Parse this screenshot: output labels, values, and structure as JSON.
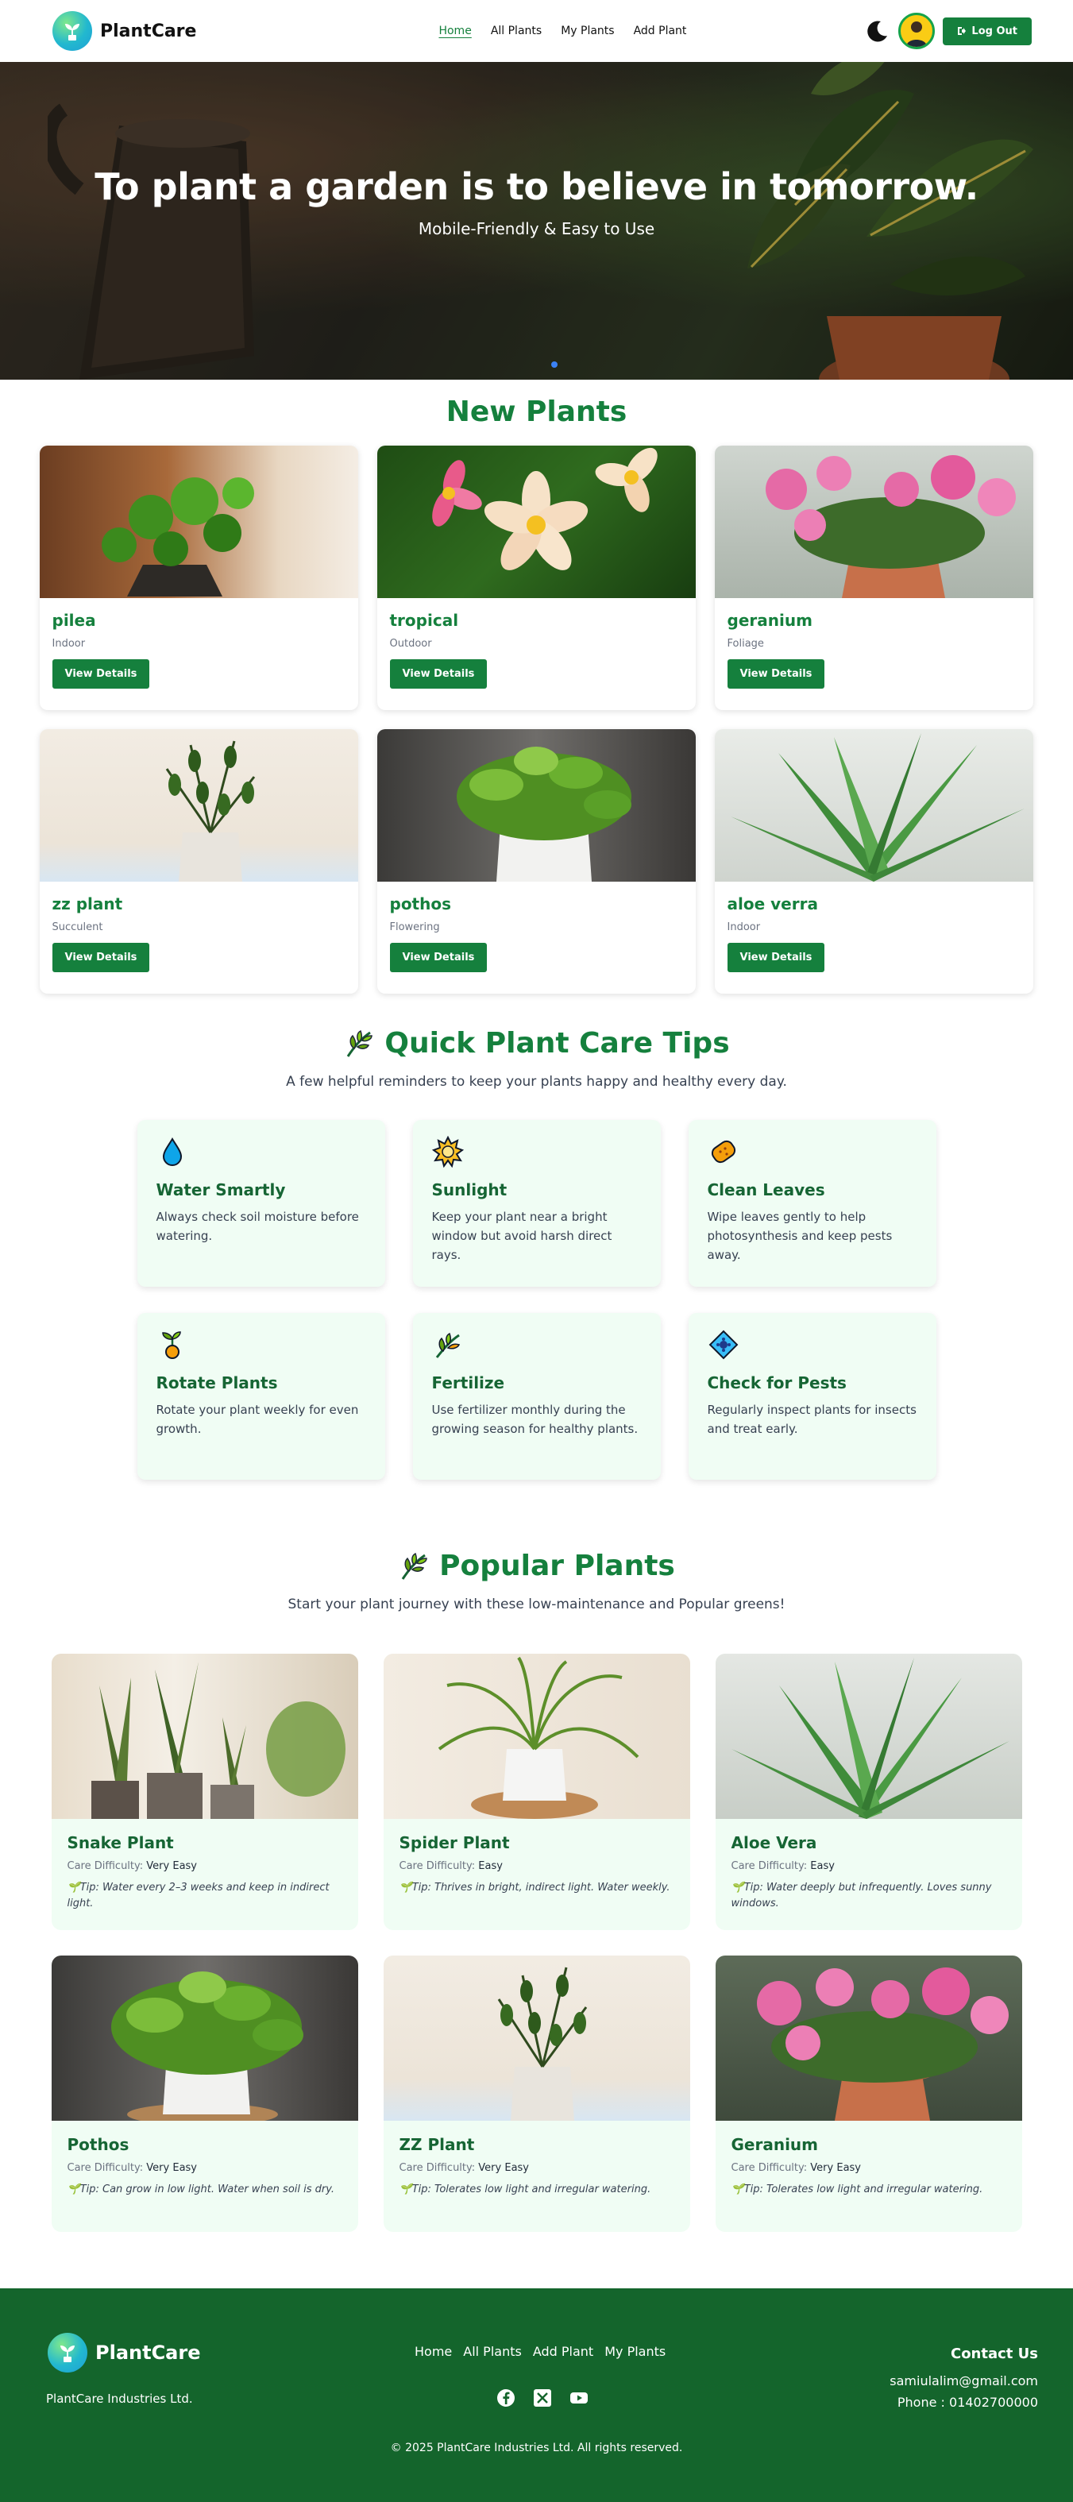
{
  "header": {
    "brand": "PlantCare",
    "nav": [
      "Home",
      "All Plants",
      "My Plants",
      "Add Plant"
    ],
    "logout_label": "Log Out"
  },
  "hero": {
    "title": "To plant a garden is to believe in tomorrow.",
    "subtitle": "Mobile-Friendly & Easy to Use"
  },
  "new_plants": {
    "title": "New Plants",
    "items": [
      {
        "name": "pilea",
        "category": "Indoor",
        "button": "View Details"
      },
      {
        "name": "tropical",
        "category": "Outdoor",
        "button": "View Details"
      },
      {
        "name": "geranium",
        "category": "Foliage",
        "button": "View Details"
      },
      {
        "name": "zz plant",
        "category": "Succulent",
        "button": "View Details"
      },
      {
        "name": "pothos",
        "category": "Flowering",
        "button": "View Details"
      },
      {
        "name": "aloe verra",
        "category": "Indoor",
        "button": "View Details"
      }
    ]
  },
  "tips": {
    "title": "Quick Plant Care Tips",
    "subtitle": "A few helpful reminders to keep your plants happy and healthy every day.",
    "items": [
      {
        "icon": "droplet-icon",
        "title": "Water Smartly",
        "text": "Always check soil moisture before watering."
      },
      {
        "icon": "sun-icon",
        "title": "Sunlight",
        "text": "Keep your plant near a bright window but avoid harsh direct rays."
      },
      {
        "icon": "sponge-icon",
        "title": "Clean Leaves",
        "text": "Wipe leaves gently to help photosynthesis and keep pests away."
      },
      {
        "icon": "sprout-icon",
        "title": "Rotate Plants",
        "text": "Rotate your plant weekly for even growth."
      },
      {
        "icon": "fertilizer-icon",
        "title": "Fertilize",
        "text": "Use fertilizer monthly during the growing season for healthy plants."
      },
      {
        "icon": "bug-icon",
        "title": "Check for Pests",
        "text": "Regularly inspect plants for insects and treat early."
      }
    ]
  },
  "popular": {
    "title": "Popular Plants",
    "subtitle": "Start your plant journey with these low-maintenance and Popular greens!",
    "difficulty_label": "Care Difficulty:",
    "items": [
      {
        "name": "Snake Plant",
        "difficulty": "Very Easy",
        "tip": "Tip: Water every 2–3 weeks and keep in indirect light."
      },
      {
        "name": "Spider Plant",
        "difficulty": "Easy",
        "tip": "Tip: Thrives in bright, indirect light. Water weekly."
      },
      {
        "name": "Aloe Vera",
        "difficulty": "Easy",
        "tip": "Tip: Water deeply but infrequently. Loves sunny windows."
      },
      {
        "name": "Pothos",
        "difficulty": "Very Easy",
        "tip": "Tip: Can grow in low light. Water when soil is dry."
      },
      {
        "name": "ZZ Plant",
        "difficulty": "Very Easy",
        "tip": "Tip: Tolerates low light and irregular watering."
      },
      {
        "name": "Geranium",
        "difficulty": "Very Easy",
        "tip": "Tip: Tolerates low light and irregular watering."
      }
    ]
  },
  "footer": {
    "brand": "PlantCare",
    "company": "PlantCare Industries Ltd.",
    "links": [
      "Home",
      "All Plants",
      "Add Plant",
      "My Plants"
    ],
    "contact_title": "Contact Us",
    "email": "samiulalim@gmail.com",
    "phone": "Phone : 01402700000",
    "copyright": "© 2025 PlantCare Industries Ltd. All rights reserved."
  },
  "colors": {
    "primary": "#15803d",
    "footer": "#14652c",
    "card_tint": "#f0fdf4"
  }
}
